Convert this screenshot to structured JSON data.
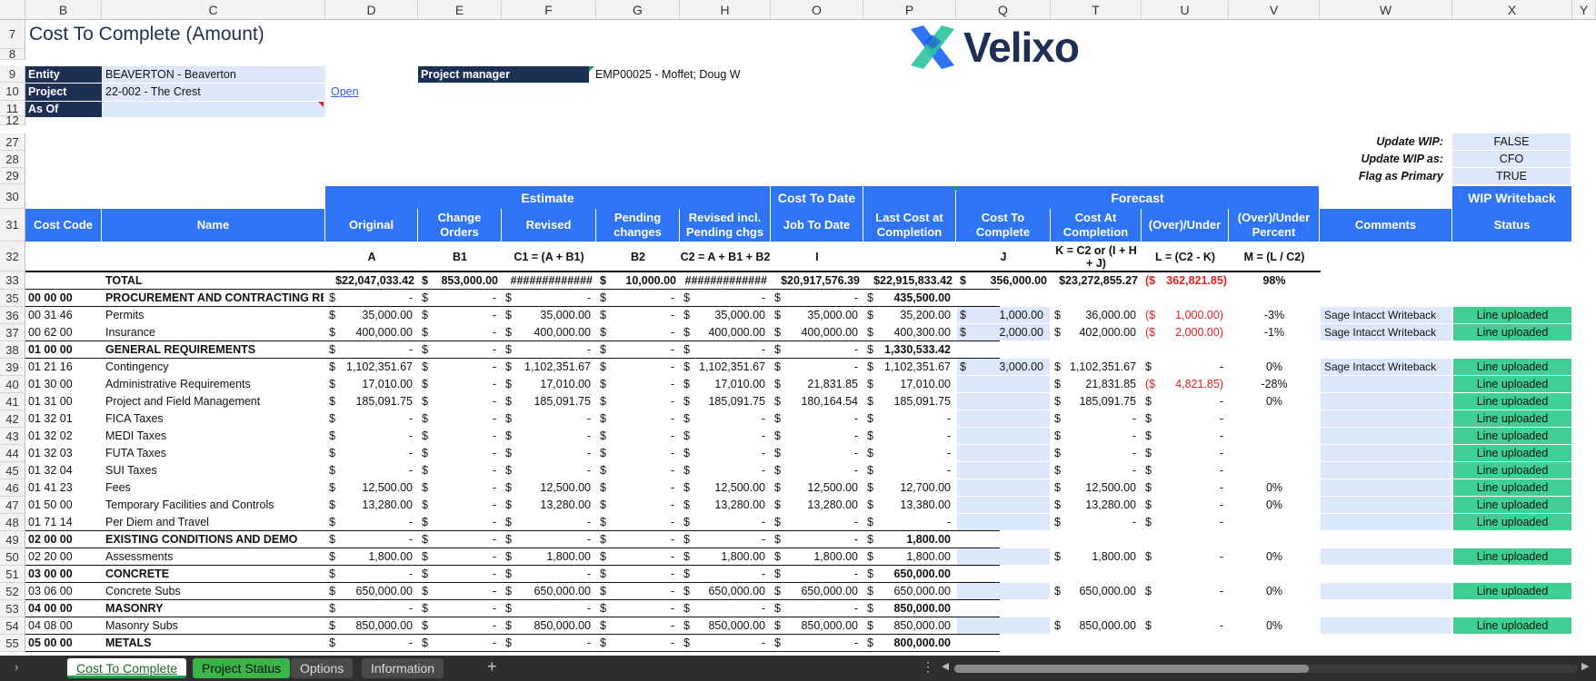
{
  "columns": [
    "B",
    "C",
    "D",
    "E",
    "F",
    "G",
    "H",
    "O",
    "P",
    "Q",
    "T",
    "U",
    "V",
    "W",
    "X",
    "Y"
  ],
  "title": "Cost To Complete (Amount)",
  "logo": {
    "brand": "Velixo"
  },
  "header_fields": {
    "entity_label": "Entity",
    "entity_value": "BEAVERTON - Beaverton",
    "project_label": "Project",
    "project_value": "22-002 - The Crest",
    "open_link": "Open",
    "asof_label": "As Of",
    "pm_label": "Project manager",
    "pm_value": "EMP00025 - Moffet; Doug W"
  },
  "flags": [
    {
      "label": "Update WIP:",
      "value": "FALSE"
    },
    {
      "label": "Update WIP as:",
      "value": "CFO"
    },
    {
      "label": "Flag as Primary",
      "value": "TRUE"
    }
  ],
  "groups": {
    "estimate": "Estimate",
    "ctd": "Cost To Date",
    "forecast": "Forecast",
    "wip": "WIP Writeback"
  },
  "col_headers": [
    "Cost Code",
    "Name",
    "Original",
    "Change Orders",
    "Revised",
    "Pending changes",
    "Revised incl. Pending chgs",
    "Job To Date",
    "Last Cost at Completion",
    "Cost To Complete",
    "Cost At Completion",
    "(Over)/Under",
    "(Over)/Under Percent",
    "Comments",
    "Status"
  ],
  "formulas": [
    "",
    "",
    "A",
    "B1",
    "C1 = (A + B1)",
    "B2",
    "C2 = A + B1 + B2",
    "I",
    "",
    "J",
    "K = C2 or (I + H + J)",
    "L = (C2 - K)",
    "M = (L / C2)",
    "",
    ""
  ],
  "total": {
    "label": "TOTAL",
    "original": "$22,047,033.42",
    "change_cur": "$",
    "change_orders": "853,000.00",
    "revised": "#############",
    "pending_cur": "$",
    "pending": "10,000.00",
    "revised_pending": "#############",
    "jtd": "$20,917,576.39",
    "lcac": "$22,915,833.42",
    "ctc_cur": "$",
    "ctc": "356,000.00",
    "cac": "$23,272,855.27",
    "ou_cur": "($",
    "ou": "362,821.85)",
    "pct": "98%"
  },
  "rows": [
    {
      "n": "35",
      "code": "00 00 00",
      "name": "PROCUREMENT AND CONTRACTING REQ",
      "h": true,
      "a": "-",
      "b1": "-",
      "c1": "-",
      "b2": "-",
      "c2": "-",
      "i": "-",
      "lcac": "435,500.00"
    },
    {
      "n": "36",
      "code": "00 31 46",
      "name": "Permits",
      "a": "35,000.00",
      "b1": "-",
      "c1": "35,000.00",
      "b2": "-",
      "c2": "35,000.00",
      "i": "35,000.00",
      "lcac": "35,200.00",
      "j": "1,000.00",
      "k": "36,000.00",
      "l": "1,000.00)",
      "lneg": true,
      "m": "-3%",
      "w": "Sage Intacct Writeback",
      "x": "Line uploaded"
    },
    {
      "n": "37",
      "code": "00 62 00",
      "name": "Insurance",
      "a": "400,000.00",
      "b1": "-",
      "c1": "400,000.00",
      "b2": "-",
      "c2": "400,000.00",
      "i": "400,000.00",
      "lcac": "400,300.00",
      "j": "2,000.00",
      "k": "402,000.00",
      "l": "2,000.00)",
      "lneg": true,
      "m": "-1%",
      "w": "Sage Intacct Writeback",
      "x": "Line uploaded"
    },
    {
      "n": "38",
      "code": "01 00 00",
      "name": "GENERAL REQUIREMENTS",
      "h": true,
      "a": "-",
      "b1": "-",
      "c1": "-",
      "b2": "-",
      "c2": "-",
      "i": "-",
      "lcac": "1,330,533.42"
    },
    {
      "n": "39",
      "code": "01 21 16",
      "name": "Contingency",
      "a": "1,102,351.67",
      "b1": "-",
      "c1": "1,102,351.67",
      "b2": "-",
      "c2": "1,102,351.67",
      "i": "-",
      "lcac": "1,102,351.67",
      "j": "3,000.00",
      "k": "1,102,351.67",
      "l": "-",
      "m": "0%",
      "w": "Sage Intacct Writeback",
      "x": "Line uploaded"
    },
    {
      "n": "40",
      "code": "01 30 00",
      "name": "Administrative Requirements",
      "a": "17,010.00",
      "b1": "-",
      "c1": "17,010.00",
      "b2": "-",
      "c2": "17,010.00",
      "i": "21,831.85",
      "lcac": "17,010.00",
      "k": "21,831.85",
      "l": "4,821.85)",
      "lneg": true,
      "m": "-28%",
      "x": "Line uploaded"
    },
    {
      "n": "41",
      "code": "01 31 00",
      "name": "Project and Field Management",
      "a": "185,091.75",
      "b1": "-",
      "c1": "185,091.75",
      "b2": "-",
      "c2": "185,091.75",
      "i": "180,164.54",
      "lcac": "185,091.75",
      "k": "185,091.75",
      "l": "-",
      "m": "0%",
      "x": "Line uploaded"
    },
    {
      "n": "42",
      "code": "01 32 01",
      "name": "FICA Taxes",
      "a": "-",
      "b1": "-",
      "c1": "-",
      "b2": "-",
      "c2": "-",
      "i": "-",
      "lcac": "-",
      "k": "-",
      "l": "-",
      "x": "Line uploaded"
    },
    {
      "n": "43",
      "code": "01 32 02",
      "name": "MEDI Taxes",
      "a": "-",
      "b1": "-",
      "c1": "-",
      "b2": "-",
      "c2": "-",
      "i": "-",
      "lcac": "-",
      "k": "-",
      "l": "-",
      "x": "Line uploaded"
    },
    {
      "n": "44",
      "code": "01 32 03",
      "name": "FUTA Taxes",
      "a": "-",
      "b1": "-",
      "c1": "-",
      "b2": "-",
      "c2": "-",
      "i": "-",
      "lcac": "-",
      "k": "-",
      "l": "-",
      "x": "Line uploaded"
    },
    {
      "n": "45",
      "code": "01 32 04",
      "name": "SUI Taxes",
      "a": "-",
      "b1": "-",
      "c1": "-",
      "b2": "-",
      "c2": "-",
      "i": "-",
      "lcac": "-",
      "k": "-",
      "l": "-",
      "x": "Line uploaded"
    },
    {
      "n": "46",
      "code": "01 41 23",
      "name": "Fees",
      "a": "12,500.00",
      "b1": "-",
      "c1": "12,500.00",
      "b2": "-",
      "c2": "12,500.00",
      "i": "12,500.00",
      "lcac": "12,700.00",
      "k": "12,500.00",
      "l": "-",
      "m": "0%",
      "x": "Line uploaded"
    },
    {
      "n": "47",
      "code": "01 50 00",
      "name": "Temporary Facilities and Controls",
      "a": "13,280.00",
      "b1": "-",
      "c1": "13,280.00",
      "b2": "-",
      "c2": "13,280.00",
      "i": "13,280.00",
      "lcac": "13,380.00",
      "k": "13,280.00",
      "l": "-",
      "m": "0%",
      "x": "Line uploaded"
    },
    {
      "n": "48",
      "code": "01 71 14",
      "name": "Per Diem and Travel",
      "a": "-",
      "b1": "-",
      "c1": "-",
      "b2": "-",
      "c2": "-",
      "i": "-",
      "lcac": "-",
      "k": "-",
      "l": "-",
      "x": "Line uploaded"
    },
    {
      "n": "49",
      "code": "02 00 00",
      "name": "EXISTING CONDITIONS AND DEMO",
      "h": true,
      "a": "-",
      "b1": "-",
      "c1": "-",
      "b2": "-",
      "c2": "-",
      "i": "-",
      "lcac": "1,800.00"
    },
    {
      "n": "50",
      "code": "02 20 00",
      "name": "Assessments",
      "a": "1,800.00",
      "b1": "-",
      "c1": "1,800.00",
      "b2": "-",
      "c2": "1,800.00",
      "i": "1,800.00",
      "lcac": "1,800.00",
      "k": "1,800.00",
      "l": "-",
      "m": "0%",
      "x": "Line uploaded"
    },
    {
      "n": "51",
      "code": "03 00 00",
      "name": "CONCRETE",
      "h": true,
      "a": "-",
      "b1": "-",
      "c1": "-",
      "b2": "-",
      "c2": "-",
      "i": "-",
      "lcac": "650,000.00"
    },
    {
      "n": "52",
      "code": "03 06 00",
      "name": "Concrete Subs",
      "a": "650,000.00",
      "b1": "-",
      "c1": "650,000.00",
      "b2": "-",
      "c2": "650,000.00",
      "i": "650,000.00",
      "lcac": "650,000.00",
      "k": "650,000.00",
      "l": "-",
      "m": "0%",
      "x": "Line uploaded"
    },
    {
      "n": "53",
      "code": "04 00 00",
      "name": "MASONRY",
      "h": true,
      "a": "-",
      "b1": "-",
      "c1": "-",
      "b2": "-",
      "c2": "-",
      "i": "-",
      "lcac": "850,000.00"
    },
    {
      "n": "54",
      "code": "04 08 00",
      "name": "Masonry Subs",
      "a": "850,000.00",
      "b1": "-",
      "c1": "850,000.00",
      "b2": "-",
      "c2": "850,000.00",
      "i": "850,000.00",
      "lcac": "850,000.00",
      "k": "850,000.00",
      "l": "-",
      "m": "0%",
      "x": "Line uploaded"
    },
    {
      "n": "55",
      "code": "05 00 00",
      "name": "METALS",
      "h": true,
      "a": "-",
      "b1": "-",
      "c1": "-",
      "b2": "-",
      "c2": "-",
      "i": "-",
      "lcac": "800,000.00"
    }
  ],
  "tabs": [
    {
      "label": "Cost To Complete",
      "active": true
    },
    {
      "label": "Project Status",
      "green": true
    },
    {
      "label": "Options"
    },
    {
      "label": "Information"
    }
  ],
  "add_sheet": "+",
  "colors": {
    "header_blue": "#2f74f5",
    "navy": "#1e2f55",
    "input_blue": "#dde9fb",
    "status_green": "#3fcf93",
    "negative_red": "#e02020"
  }
}
